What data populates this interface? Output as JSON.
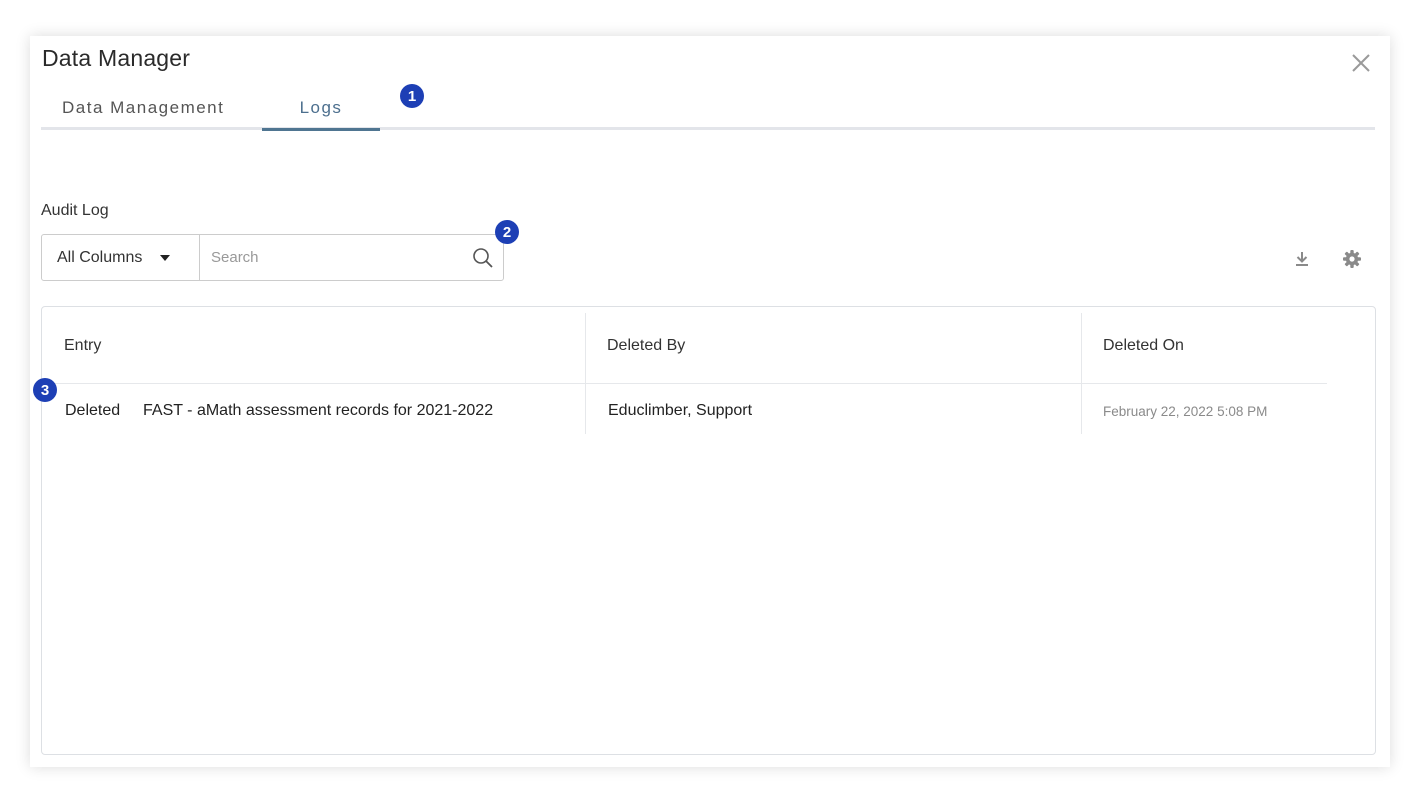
{
  "dialog": {
    "title": "Data Manager",
    "close_icon": "close-icon"
  },
  "tabs": [
    {
      "label": "Data Management",
      "active": false
    },
    {
      "label": "Logs",
      "active": true
    }
  ],
  "markers": [
    "1",
    "2",
    "3"
  ],
  "audit": {
    "section_title": "Audit Log",
    "column_filter": "All Columns",
    "search_placeholder": "Search",
    "icons": {
      "search": "search-icon",
      "download": "download-icon",
      "settings": "gear-icon"
    }
  },
  "table": {
    "columns": [
      "Entry",
      "Deleted By",
      "Deleted On"
    ],
    "rows": [
      {
        "action": "Deleted",
        "entry": "FAST - aMath assessment records for 2021-2022",
        "deleted_by": "Educlimber, Support",
        "deleted_on": "February 22, 2022 5:08 PM"
      }
    ]
  },
  "colors": {
    "active_tab": "#4f7591",
    "marker": "#1d3fb5"
  }
}
